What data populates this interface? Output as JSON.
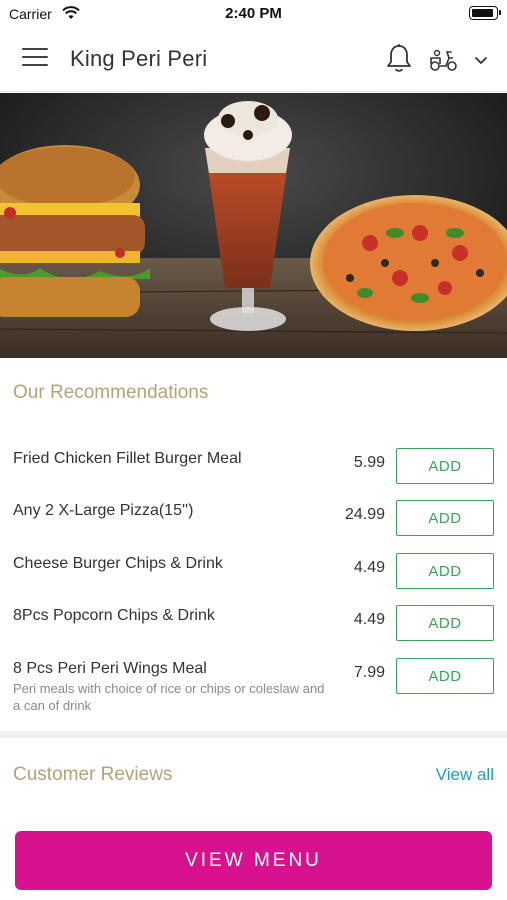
{
  "status_bar": {
    "carrier": "Carrier",
    "time": "2:40 PM"
  },
  "header": {
    "title": "King Peri Peri",
    "icons": {
      "menu": "hamburger-menu-icon",
      "bell": "bell-icon",
      "delivery": "scooter-icon",
      "dropdown": "chevron-down-icon"
    }
  },
  "hero": {
    "content": "burger, milkshake and pizza banner"
  },
  "recommendations": {
    "title": "Our Recommendations",
    "items": [
      {
        "name": "Fried Chicken Fillet Burger Meal",
        "price": "5.99",
        "add": "ADD"
      },
      {
        "name": "Any 2 X-Large Pizza(15'')",
        "price": "24.99",
        "add": "ADD"
      },
      {
        "name": "Cheese Burger Chips & Drink",
        "price": "4.49",
        "add": "ADD"
      },
      {
        "name": "8Pcs Popcorn Chips & Drink",
        "price": "4.49",
        "add": "ADD"
      },
      {
        "name": "8 Pcs Peri Peri Wings Meal",
        "description": "Peri meals with choice of rice or chips or coleslaw and a can of drink",
        "price": "7.99",
        "add": "ADD"
      }
    ]
  },
  "reviews": {
    "title": "Customer Reviews",
    "view_all": "View all"
  },
  "footer": {
    "view_menu": "VIEW MENU"
  },
  "colors": {
    "accent": "#d8128e",
    "add_green": "#3aa35a",
    "section_gold": "#b8a077",
    "link_blue": "#1a9cc7"
  }
}
